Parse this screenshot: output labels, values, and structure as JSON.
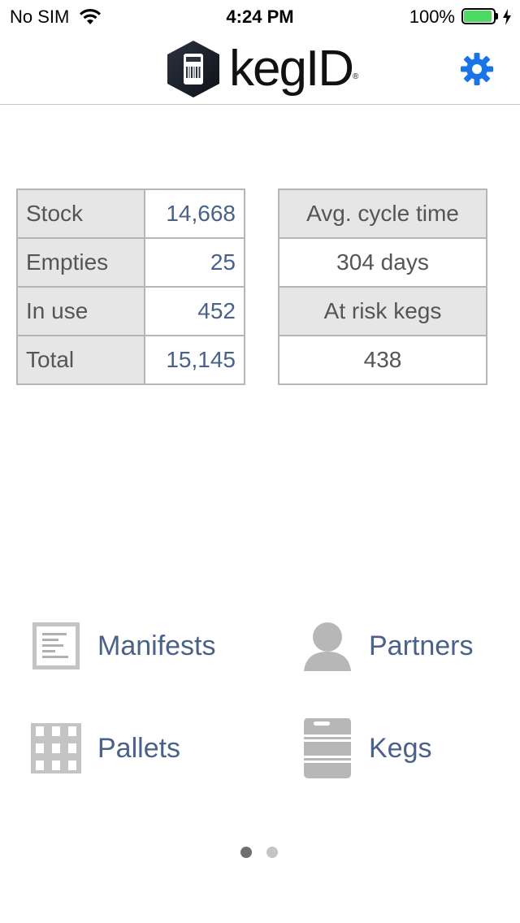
{
  "status_bar": {
    "carrier": "No SIM",
    "time": "4:24 PM",
    "battery": "100%",
    "battery_color": "#4cd964"
  },
  "nav": {
    "logo_text_keg": "keg",
    "logo_text_id": "ID",
    "logo_reg": "®",
    "settings_icon": "gear-icon",
    "accent_color": "#1a73e8"
  },
  "stock_table": {
    "rows": [
      {
        "label": "Stock",
        "value": "14,668"
      },
      {
        "label": "Empties",
        "value": "25"
      },
      {
        "label": "In use",
        "value": "452"
      },
      {
        "label": "Total",
        "value": "15,145"
      }
    ]
  },
  "metrics_table": {
    "avg_cycle_label": "Avg. cycle time",
    "avg_cycle_value": "304 days",
    "at_risk_label": "At risk kegs",
    "at_risk_value": "438"
  },
  "menu": {
    "manifests": "Manifests",
    "partners": "Partners",
    "pallets": "Pallets",
    "kegs": "Kegs"
  },
  "pager": {
    "pages": 2,
    "current": 1
  }
}
